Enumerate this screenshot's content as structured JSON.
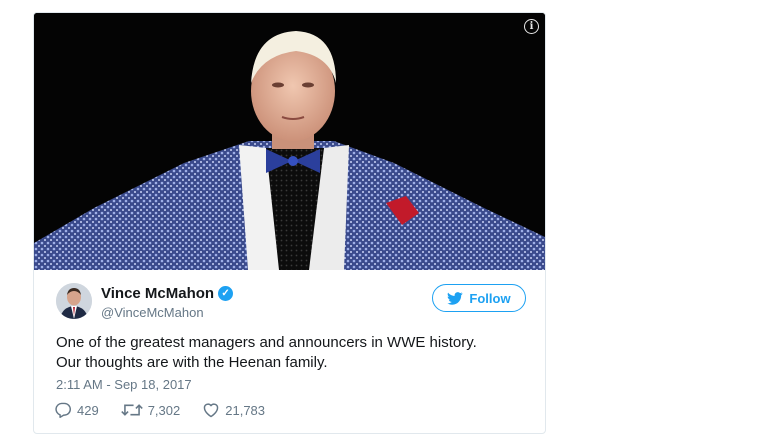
{
  "tweet": {
    "author_name": "Vince McMahon",
    "handle": "@VinceMcMahon",
    "follow_label": "Follow",
    "text_line1": "One of the greatest managers and announcers in WWE history.",
    "text_line2": "Our thoughts are with the Heenan family.",
    "timestamp": "2:11 AM - Sep 18, 2017",
    "replies": "429",
    "retweets": "7,302",
    "likes": "21,783"
  },
  "icons": {
    "info": "info-icon",
    "verified": "verified-badge-icon",
    "twitter_bird": "twitter-bird-icon",
    "reply": "reply-icon",
    "retweet": "retweet-icon",
    "like": "heart-icon"
  },
  "colors": {
    "accent": "#1da1f2",
    "text": "#14171a",
    "muted": "#657786",
    "border": "#e1e8ed"
  }
}
